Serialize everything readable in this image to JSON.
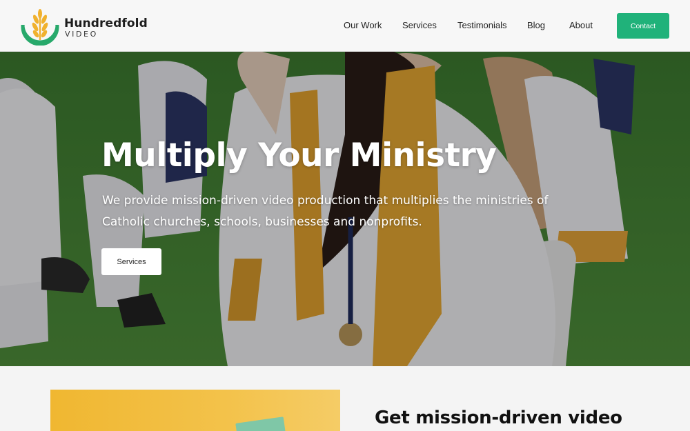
{
  "brand": {
    "name": "Hundredfold",
    "sub": "VIDEO",
    "colors": {
      "accent": "#20b27a",
      "logo_ring": "#27a96b",
      "logo_wheat": "#f0b12e"
    }
  },
  "nav": {
    "items": [
      "Our Work",
      "Services",
      "Testimonials",
      "Blog",
      "About"
    ],
    "contact_label": "Contact"
  },
  "hero": {
    "title": "Multiply Your Ministry",
    "text": "We provide mission-driven video production that multiplies the ministries of Catholic churches, schools, businesses and nonprofits.",
    "button_label": "Services"
  },
  "section2": {
    "heading": "Get mission-driven video"
  }
}
